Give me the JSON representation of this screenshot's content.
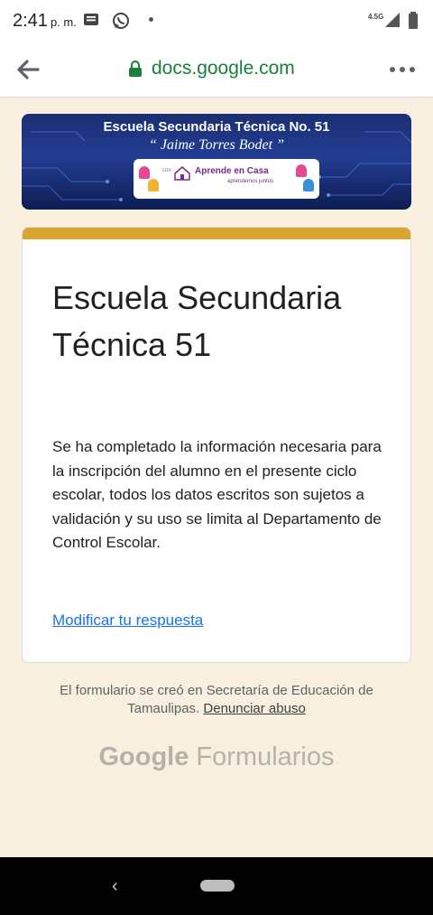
{
  "status_bar": {
    "time": "2:41",
    "ampm": "p. m.",
    "network": "4.5G"
  },
  "browser": {
    "url": "docs.google.com"
  },
  "banner": {
    "title": "Escuela Secundaria Técnica No. 51",
    "subtitle": "“ Jaime Torres Bodet ”",
    "badge_con": "con",
    "badge_title": "Aprende en Casa",
    "badge_tagline": "aprendemos juntos"
  },
  "card": {
    "accent_color": "#d9a430",
    "title": "Escuela Secundaria Técnica 51",
    "message": "Se ha completado la información necesaria para la inscripción del alumno en el presente ciclo escolar, todos los datos escritos son sujetos a validación y su uso se limita al Departamento de Control Escolar.",
    "edit_link": "Modificar tu respuesta"
  },
  "footer": {
    "note": "El formulario se creó en Secretaría de Educación de Tamaulipas.",
    "report_link": "Denunciar abuso",
    "brand_google": "Google",
    "brand_product": "Formularios"
  },
  "nav": {
    "back_icon": "chevron-left-icon",
    "home_icon": "home-pill-icon"
  }
}
